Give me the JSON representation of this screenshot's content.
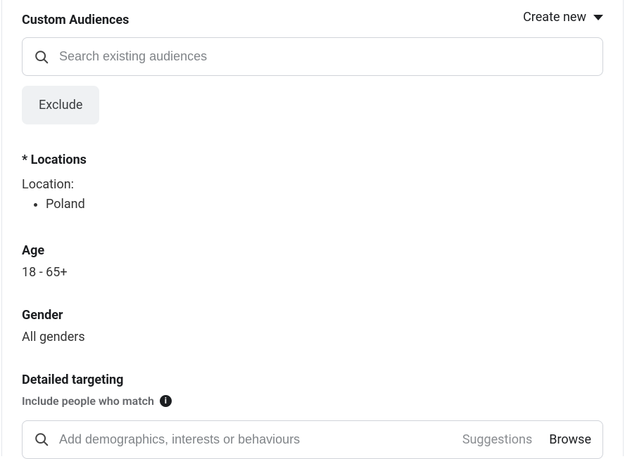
{
  "customAudiences": {
    "title": "Custom Audiences",
    "createNew": "Create new",
    "searchPlaceholder": "Search existing audiences",
    "excludeLabel": "Exclude"
  },
  "locations": {
    "title": "* Locations",
    "label": "Location:",
    "items": [
      "Poland"
    ]
  },
  "age": {
    "title": "Age",
    "value": "18 - 65+"
  },
  "gender": {
    "title": "Gender",
    "value": "All genders"
  },
  "detailedTargeting": {
    "title": "Detailed targeting",
    "includeLabel": "Include people who match",
    "addPlaceholder": "Add demographics, interests or behaviours",
    "suggestions": "Suggestions",
    "browse": "Browse"
  }
}
